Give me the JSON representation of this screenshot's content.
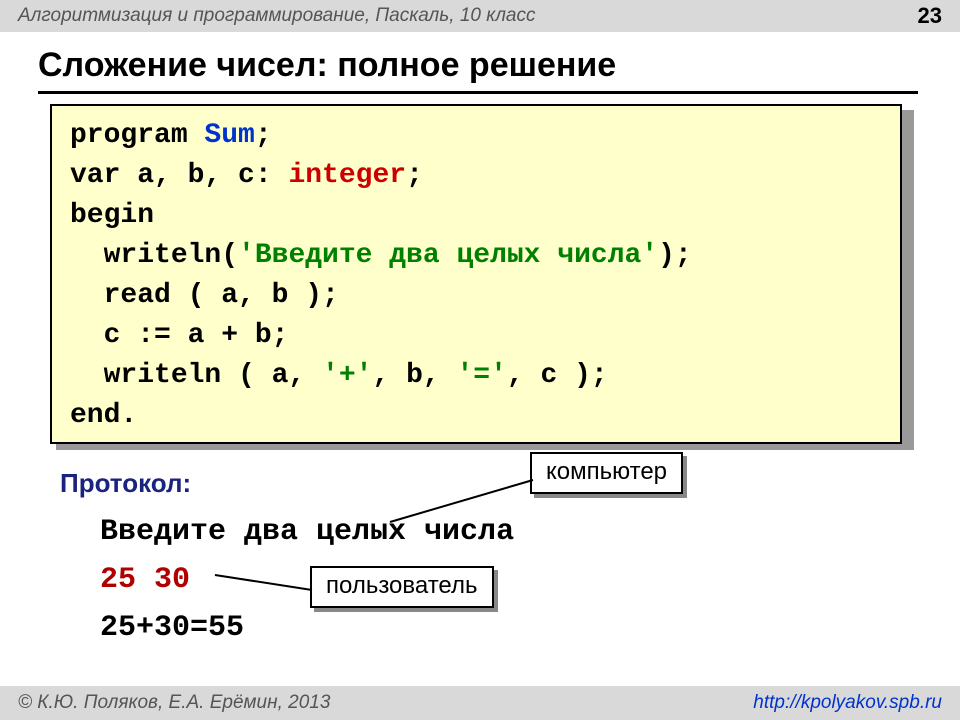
{
  "header": {
    "course": "Алгоритмизация и программирование, Паскаль, 10 класс",
    "page": "23"
  },
  "title": "Сложение чисел: полное решение",
  "code": {
    "l1a": "program ",
    "l1b": "Sum",
    "l1c": ";",
    "l2a": "var a, b, c: ",
    "l2b": "integer",
    "l2c": ";",
    "l3": "begin",
    "l4a": "  writeln(",
    "l4b": "'Введите два целых числа'",
    "l4c": ");",
    "l5": "  read ( a, b );",
    "l6": "  c := a + b;",
    "l7a": "  writeln ( a, ",
    "l7b": "'+'",
    "l7c": ", b, ",
    "l7d": "'='",
    "l7e": ", c );",
    "l8": "end."
  },
  "protocol_label": "Протокол:",
  "protocol": {
    "prompt": "Введите два целых числа",
    "input": "25 30",
    "output": "25+30=55"
  },
  "callouts": {
    "computer": "компьютер",
    "user": "пользователь"
  },
  "footer": {
    "copyright": "© К.Ю. Поляков, Е.А. Ерёмин, 2013",
    "url": "http://kpolyakov.spb.ru"
  }
}
